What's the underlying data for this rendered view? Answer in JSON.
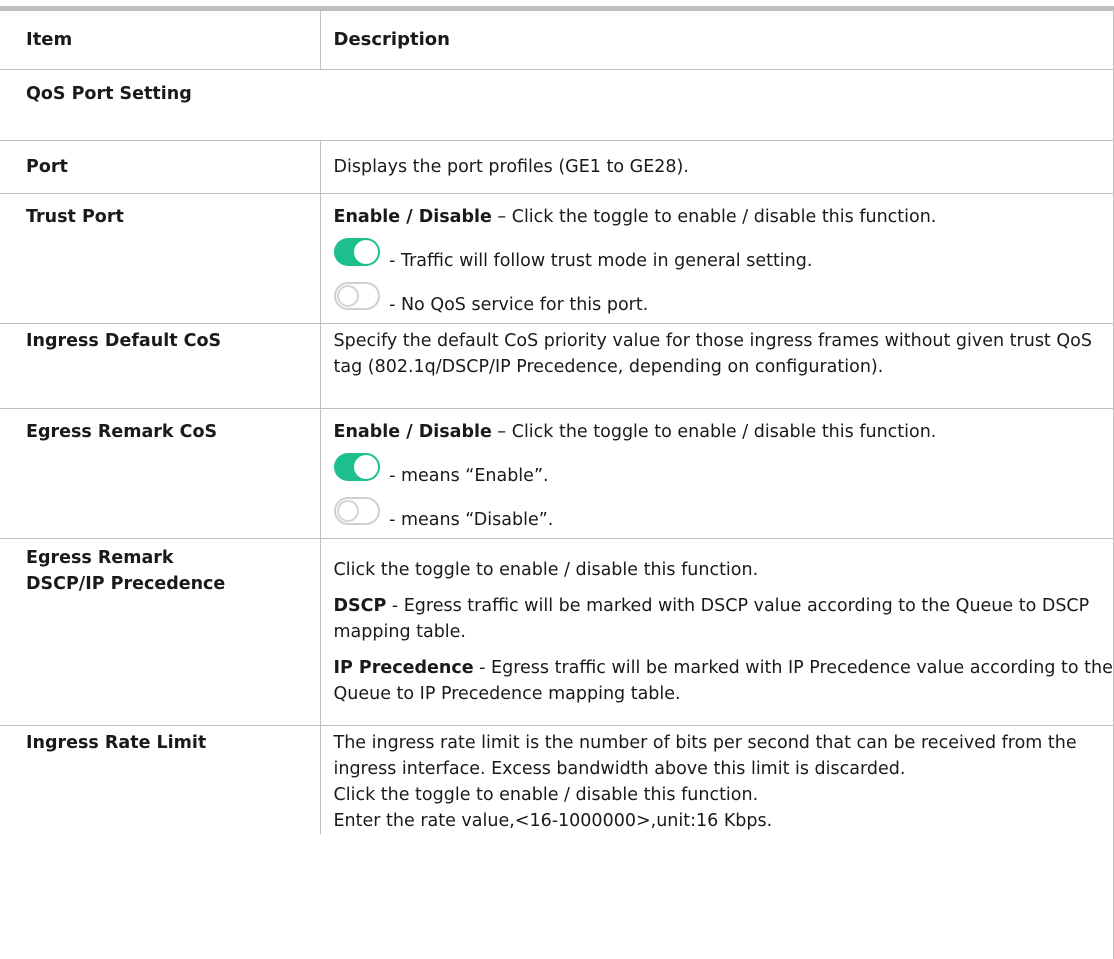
{
  "header": {
    "item": "Item",
    "description": "Description"
  },
  "section_title": "QoS Port Setting",
  "rows": {
    "port": {
      "item": "Port",
      "text": "Displays the port profiles (GE1 to GE28)."
    },
    "trust_port": {
      "item": "Trust Port",
      "intro_bold": "Enable / Disable",
      "intro_rest": " – Click the toggle to enable / disable this function.",
      "on_text": "- Traffic will follow trust mode in general setting.",
      "off_text": "- No QoS service for this port."
    },
    "ingress_default_cos": {
      "item": "Ingress Default CoS",
      "text": "Specify the default CoS priority value for those ingress frames without given trust QoS tag (802.1q/DSCP/IP Precedence, depending on configuration)."
    },
    "egress_remark_cos": {
      "item": "Egress Remark CoS",
      "intro_bold": "Enable / Disable",
      "intro_rest": " – Click the toggle to enable / disable this function.",
      "on_text": "- means “Enable”.",
      "off_text": "- means “Disable”."
    },
    "egress_remark_dscp": {
      "item_line1": "Egress Remark",
      "item_line2": "DSCP/IP Precedence",
      "intro": "Click the toggle to enable / disable this function.",
      "dscp_bold": "DSCP",
      "dscp_rest": " - Egress traffic will be marked with DSCP value according to the Queue to DSCP mapping table.",
      "ipp_bold": "IP Precedence",
      "ipp_rest": " - Egress traffic will be marked with IP Precedence value according to the Queue to IP Precedence mapping table."
    },
    "ingress_rate_limit": {
      "item": "Ingress Rate Limit",
      "text1": "The ingress rate limit is the number of bits per second that can be received from the ingress interface. Excess bandwidth above this limit is discarded.",
      "text2": "Click the toggle to enable / disable this function.",
      "text3": "Enter the rate value,<16-1000000>,unit:16 Kbps."
    }
  },
  "colors": {
    "toggle_on": "#1dbf8e",
    "rule": "#bfbfbf"
  },
  "icons": {
    "toggle_on": "toggle-on-icon",
    "toggle_off": "toggle-off-icon"
  }
}
